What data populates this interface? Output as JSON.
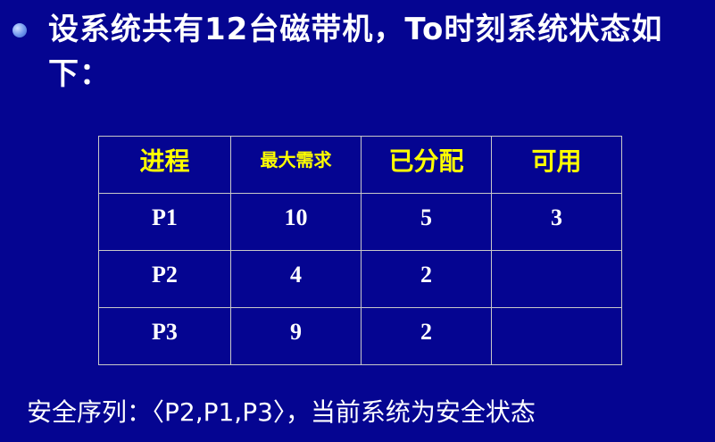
{
  "slide": {
    "heading": "设系统共有12台磁带机，To时刻系统状态如下：",
    "table": {
      "headers": [
        "进程",
        "最大需求",
        "已分配",
        "可用"
      ],
      "rows": [
        [
          "P1",
          "10",
          "5",
          "3"
        ],
        [
          "P2",
          "4",
          "2",
          ""
        ],
        [
          "P3",
          "9",
          "2",
          ""
        ]
      ]
    },
    "footer": "安全序列：〈P2,P1,P3〉，当前系统为安全状态"
  },
  "colors": {
    "background": "#050591",
    "header_text": "#ffff00",
    "body_text": "#ffffff",
    "grid": "#c8c8c8"
  },
  "icons": {
    "bullet": "bullet-dot-icon"
  }
}
